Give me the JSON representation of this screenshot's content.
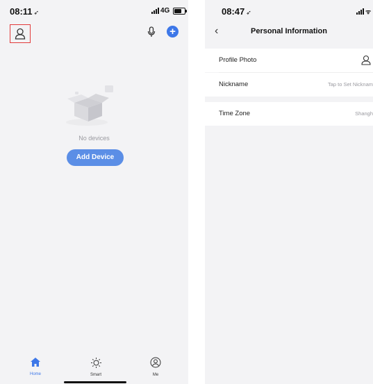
{
  "left_screen": {
    "status": {
      "time": "08:11",
      "network": "4G"
    },
    "empty_state": {
      "text": "No devices",
      "button_label": "Add Device"
    },
    "tabs": [
      {
        "label": "Home",
        "icon": "home-icon",
        "active": true
      },
      {
        "label": "Smart",
        "icon": "sun-icon",
        "active": false
      },
      {
        "label": "Me",
        "icon": "profile-icon",
        "active": false
      }
    ],
    "colors": {
      "accent": "#3d77e8",
      "button": "#5b8ee6",
      "highlight_box": "#e23a3a"
    }
  },
  "right_screen": {
    "status": {
      "time": "08:47"
    },
    "title": "Personal Information",
    "rows": [
      {
        "label": "Profile Photo",
        "value": ""
      },
      {
        "label": "Nickname",
        "value": "Tap to Set Nicknam"
      },
      {
        "label": "Time Zone",
        "value": "Shangh"
      }
    ]
  }
}
